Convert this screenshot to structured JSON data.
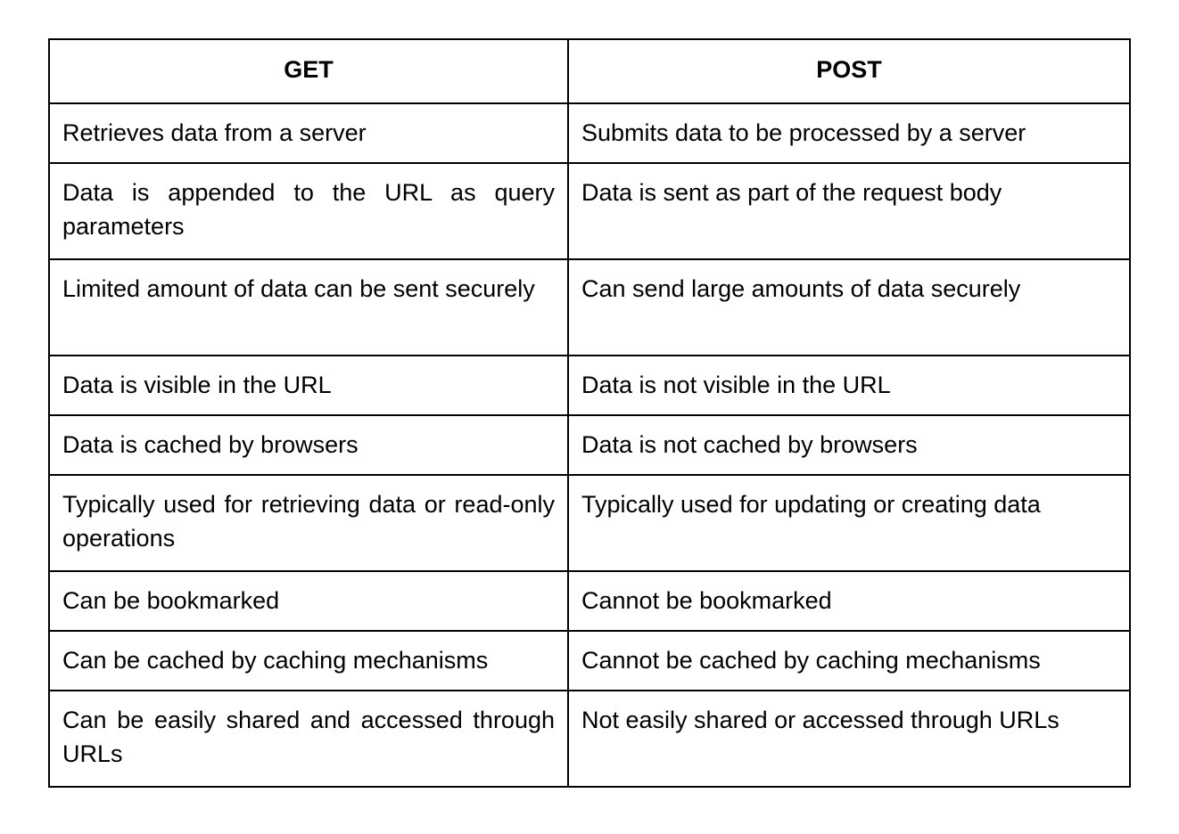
{
  "table": {
    "headers": [
      "GET",
      "POST"
    ],
    "rows": [
      {
        "get": "Retrieves data from a server",
        "post": "Submits data to be processed by a server"
      },
      {
        "get": "Data is appended to the URL as query parameters",
        "post": "Data is sent as part of the request body"
      },
      {
        "get": "Limited amount of data can be sent securely",
        "post": "Can send large amounts of data securely"
      },
      {
        "get": "Data is visible in the URL",
        "post": "Data is not visible in the URL"
      },
      {
        "get": "Data is cached by browsers",
        "post": "Data is not cached by browsers"
      },
      {
        "get": "Typically used for retrieving data or read-only operations",
        "post": "Typically used for updating or creating data"
      },
      {
        "get": "Can be bookmarked",
        "post": "Cannot be bookmarked"
      },
      {
        "get": "Can be cached by caching mechanisms",
        "post": "Cannot be cached by caching mechanisms"
      },
      {
        "get": "Can be easily shared and accessed through URLs",
        "post": "Not easily shared or accessed through URLs"
      }
    ]
  }
}
